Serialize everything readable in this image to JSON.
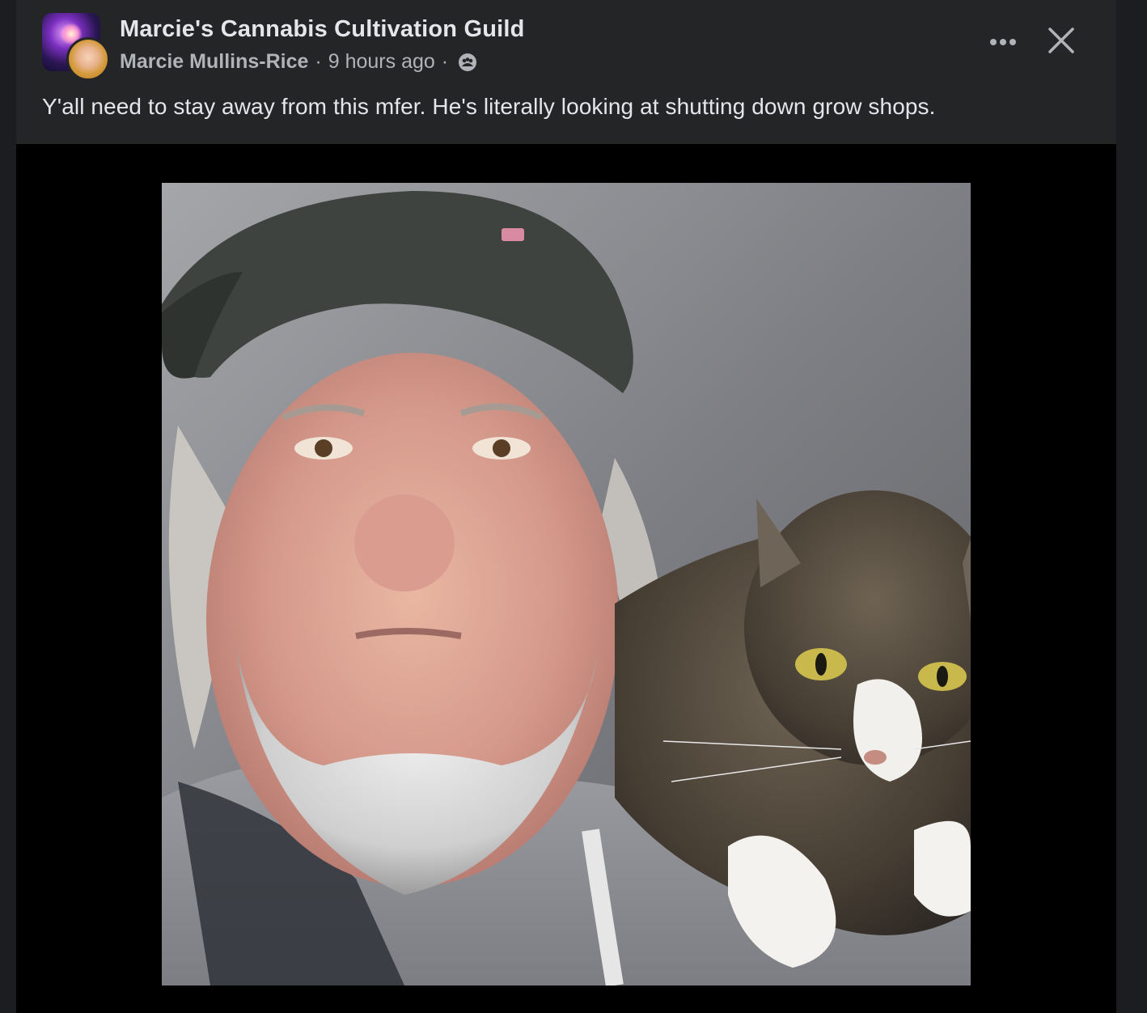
{
  "post": {
    "group_name": "Marcie's Cannabis Cultivation Guild",
    "author": "Marcie Mullins-Rice",
    "separator": "·",
    "timestamp": "9 hours ago",
    "audience_icon": "group-members-icon",
    "text": "Y'all need to stay away from this mfer. He's literally looking at shutting down grow shops."
  },
  "actions": {
    "more_icon": "more-options-icon",
    "close_icon": "close-icon"
  },
  "media": {
    "description_icon": "photo"
  },
  "colors": {
    "background": "#242526",
    "primary_text": "#e4e6eb",
    "secondary_text": "#b0b3b8",
    "media_backdrop": "#000000"
  }
}
